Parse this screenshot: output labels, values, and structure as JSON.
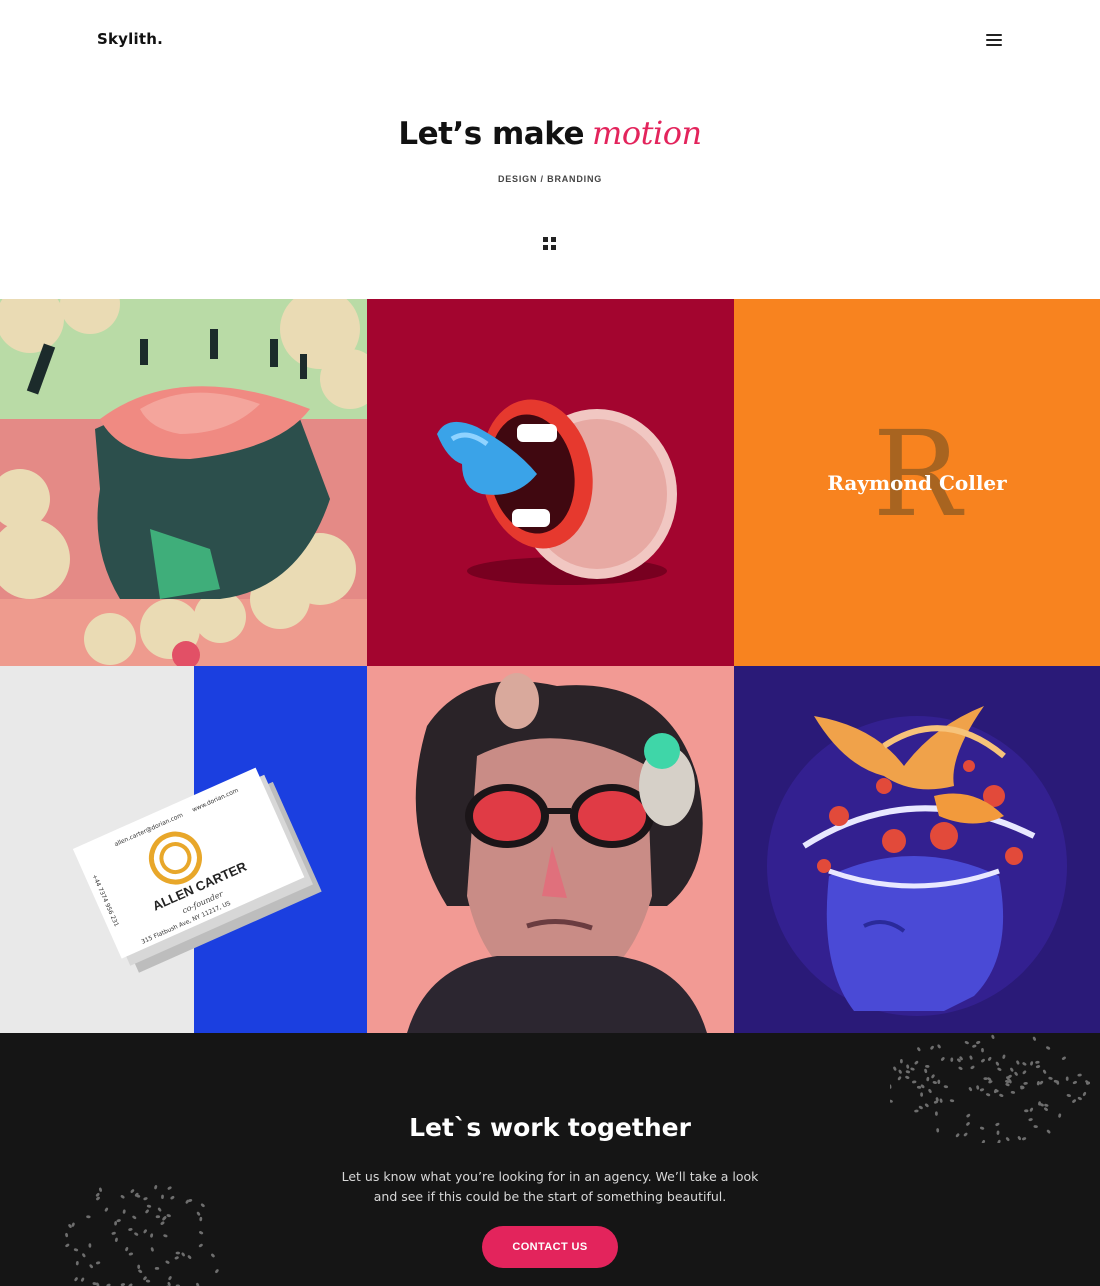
{
  "header": {
    "logo": "Skylith.",
    "menu_icon": "hamburger-menu-icon"
  },
  "hero": {
    "title_main": "Let’s make",
    "title_accent": "motion",
    "subtitle": "DESIGN / BRANDING",
    "view_icon": "grid-view-icon"
  },
  "portfolio": {
    "tiles": [
      {
        "kind": "illustration",
        "subject": "head with clouds and figures"
      },
      {
        "kind": "illustration",
        "subject": "mouth cup with tongue"
      },
      {
        "kind": "branding",
        "letter": "R",
        "name": "Raymond Coller"
      },
      {
        "kind": "business-cards",
        "card_name": "ALLEN CARTER",
        "card_role": "co-founder",
        "card_email": "allen.carter@dorian.com",
        "card_site": "www.dorian.com",
        "card_address": "315 Flatbush Ave, NY 11217, US",
        "card_phone": "+44 7374 956 231"
      },
      {
        "kind": "illustration",
        "subject": "portrait with sunglasses"
      },
      {
        "kind": "illustration",
        "subject": "blue head with birds"
      }
    ]
  },
  "cta": {
    "title": "Let`s work together",
    "text": "Let us know what you’re looking for in an agency. We’ll take a look and see if this could be the start of something beautiful.",
    "button": "CONTACT US"
  },
  "colors": {
    "accent": "#e3245c",
    "dark": "#151515",
    "crimson_tile": "#a3052f",
    "orange_tile": "#f8831f",
    "navy_tile": "#2a1a78",
    "blue_tile": "#1b3fe0"
  }
}
